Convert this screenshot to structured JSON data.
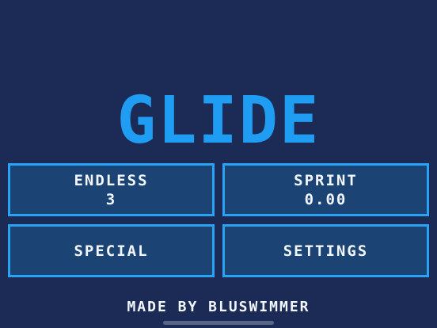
{
  "game": {
    "title": "GLIDE",
    "credit": "MADE BY BLUSWIMMER"
  },
  "menu": {
    "endless": {
      "label": "ENDLESS",
      "value": "3"
    },
    "sprint": {
      "label": "SPRINT",
      "value": "0.00"
    },
    "special": {
      "label": "SPECIAL"
    },
    "settings": {
      "label": "SETTINGS"
    }
  },
  "colors": {
    "background": "#1b2b55",
    "accent": "#1f9df2",
    "button_fill": "#1b4374",
    "button_border": "#2aa3f5",
    "text": "#f2f6ff"
  }
}
